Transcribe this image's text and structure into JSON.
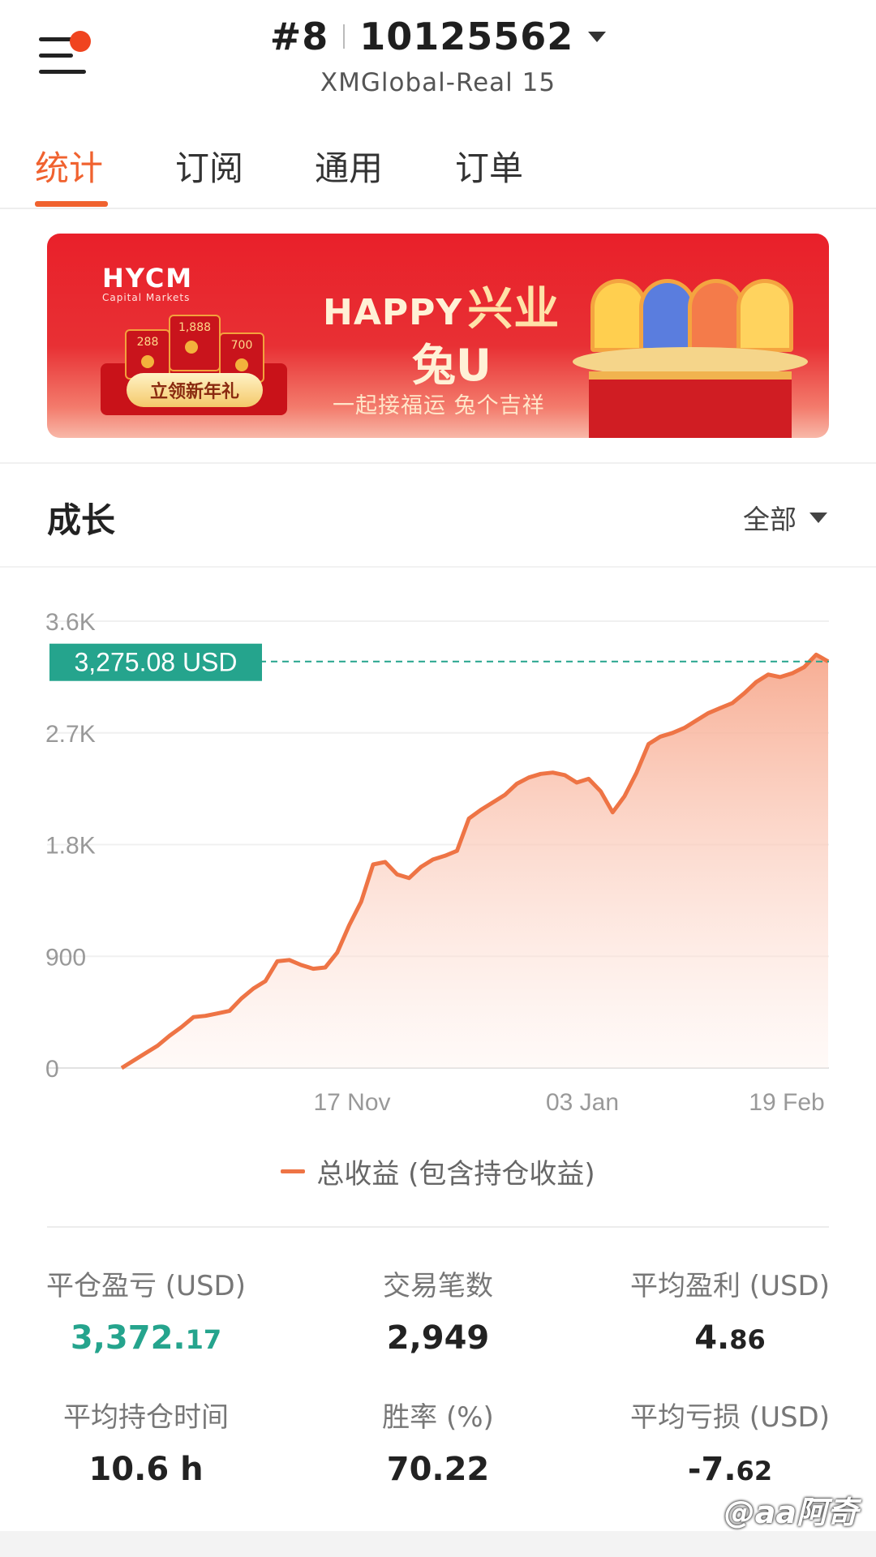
{
  "header": {
    "account_prefix": "#8",
    "account_number": "10125562",
    "server": "XMGlobal-Real 15"
  },
  "tabs": [
    "统计",
    "订阅",
    "通用",
    "订单"
  ],
  "banner": {
    "logo": "HYCM",
    "logo_sub": "Capital Markets",
    "envelopes": [
      "288",
      "1,888",
      "700"
    ],
    "cta": "立领新年礼",
    "happy": "HAPPY",
    "happy_cn": "兴业",
    "rabbit": "兔U",
    "slogan": "一起接福运 兔个吉祥"
  },
  "growth": {
    "title": "成长",
    "filter": "全部"
  },
  "chart_data": {
    "type": "area",
    "y_ticks": [
      "3.6K",
      "2.7K",
      "1.8K",
      "900",
      "0"
    ],
    "ylim": [
      0,
      3600
    ],
    "x_ticks": [
      "17 Nov",
      "03 Jan",
      "19 Feb"
    ],
    "current_label": "3,275.08 USD",
    "current_value": 3275.08,
    "legend": "总收益 (包含持仓收益)",
    "line_color": "#ee7445",
    "marker_color": "#25a48d",
    "series": [
      {
        "values": [
          0,
          60,
          120,
          180,
          260,
          330,
          410,
          420,
          440,
          460,
          560,
          640,
          700,
          860,
          870,
          830,
          800,
          810,
          930,
          1150,
          1340,
          1640,
          1660,
          1560,
          1530,
          1620,
          1680,
          1710,
          1750,
          2010,
          2080,
          2140,
          2200,
          2290,
          2340,
          2370,
          2380,
          2360,
          2300,
          2330,
          2230,
          2060,
          2190,
          2380,
          2610,
          2670,
          2700,
          2740,
          2800,
          2860,
          2900,
          2940,
          3020,
          3110,
          3170,
          3150,
          3180,
          3230,
          3330,
          3275
        ]
      }
    ]
  },
  "stats": [
    {
      "label": "平仓盈亏 (USD)",
      "int": "3,372.",
      "dec": "17",
      "highlight": true
    },
    {
      "label": "交易笔数",
      "int": "2,949",
      "dec": ""
    },
    {
      "label": "平均盈利 (USD)",
      "int": "4.",
      "dec": "86"
    },
    {
      "label": "平均持仓时间",
      "int": "10.6 h",
      "dec": ""
    },
    {
      "label": "胜率 (%)",
      "int": "70.22",
      "dec": ""
    },
    {
      "label": "平均亏损 (USD)",
      "int": "-7.",
      "dec": "62"
    }
  ],
  "watermark": "@aa阿奇"
}
